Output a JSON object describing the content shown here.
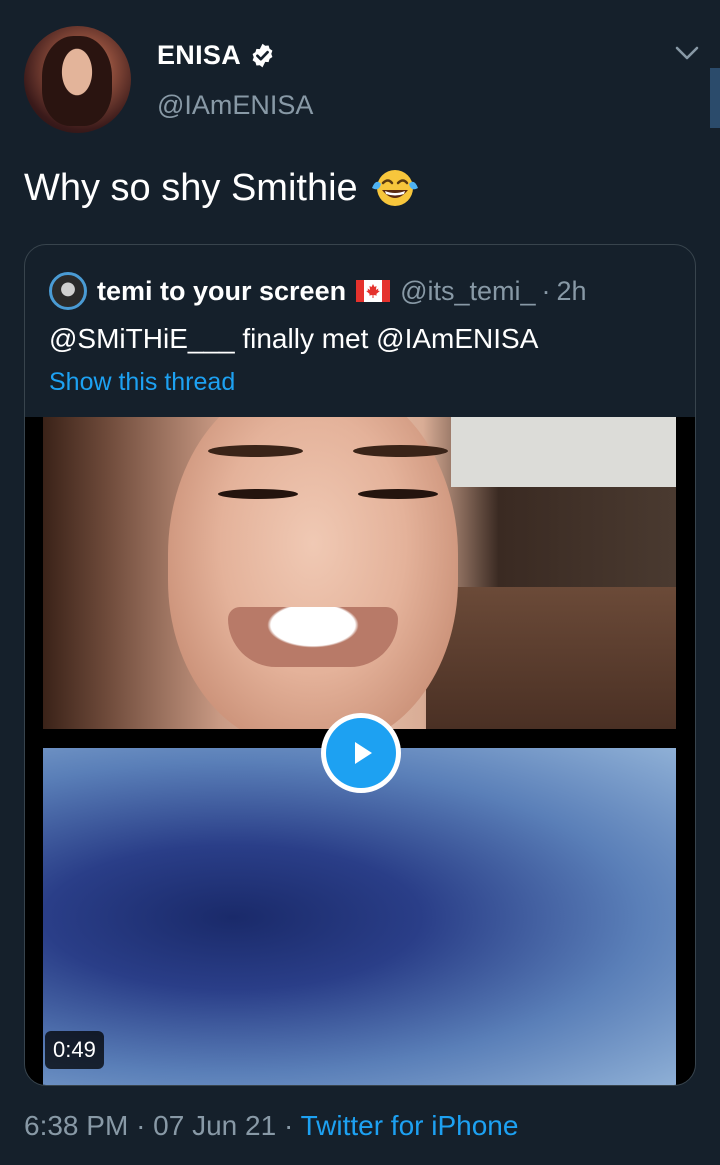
{
  "tweet": {
    "author": {
      "display_name": "ENISA",
      "handle": "@IAmENISA",
      "verified": true,
      "avatar_icon": "profile-photo"
    },
    "text": "Why so shy Smithie",
    "emoji_icon": "face-with-tears-of-joy",
    "menu_icon": "chevron-down-icon"
  },
  "quote": {
    "author_name": "temi to your screen",
    "flag_icon": "canada-flag",
    "author_handle": "@its_temi_",
    "separator": "·",
    "time_ago": "2h",
    "text": "@SMiTHiE___ finally met @IAmENISA",
    "thread_link": "Show this thread",
    "video": {
      "duration": "0:49",
      "play_icon": "play-icon"
    }
  },
  "footer": {
    "time": "6:38 PM",
    "sep1": "·",
    "date": "07 Jun 21",
    "sep2": "·",
    "source": "Twitter for iPhone"
  },
  "colors": {
    "background": "#15202b",
    "accent": "#1da1f2",
    "muted": "#8899a6",
    "border": "#38444d"
  }
}
